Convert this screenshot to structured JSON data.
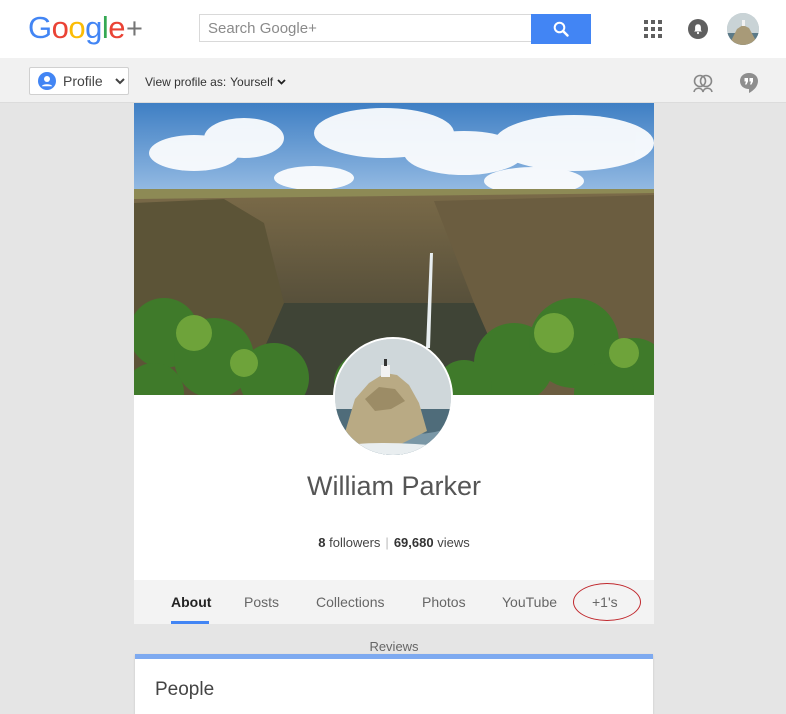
{
  "header": {
    "logo": {
      "letters": [
        "G",
        "o",
        "o",
        "g",
        "l",
        "e"
      ],
      "plus": "+"
    },
    "search": {
      "placeholder": "Search Google+"
    },
    "icons": {
      "search": "search-icon",
      "apps": "apps-grid-icon",
      "notifications": "bell-icon",
      "account": "account-avatar"
    }
  },
  "subbar": {
    "profile_label": "Profile",
    "view_as_label": "View profile as:",
    "view_as_value": "Yourself",
    "right_icons": [
      "hangouts-icon",
      "quote-icon"
    ]
  },
  "profile": {
    "name": "William Parker",
    "followers_count": "8",
    "followers_label": "followers",
    "views_count": "69,680",
    "views_label": "views",
    "tabs": [
      {
        "label": "About",
        "active": true
      },
      {
        "label": "Posts",
        "active": false
      },
      {
        "label": "Collections",
        "active": false
      },
      {
        "label": "Photos",
        "active": false
      },
      {
        "label": "YouTube",
        "active": false
      },
      {
        "label": "+1's",
        "active": false,
        "circled": true
      }
    ]
  },
  "sections": {
    "reviews_label": "Reviews",
    "people_title": "People"
  },
  "colors": {
    "accent": "#4285f4",
    "annotation": "#c0282d"
  }
}
